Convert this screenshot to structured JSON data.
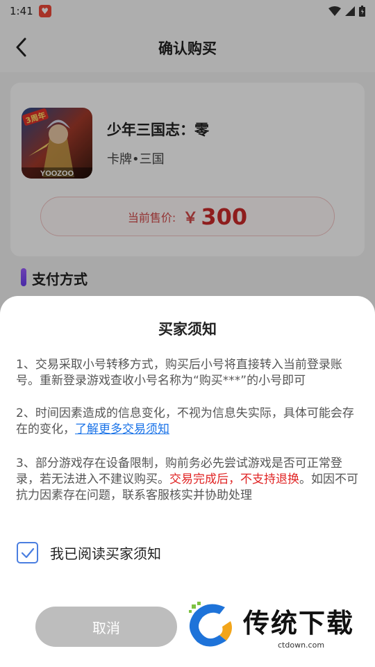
{
  "status_bar": {
    "time": "1:41"
  },
  "nav": {
    "title": "确认购买"
  },
  "product": {
    "badge": "3周年",
    "publisher_text": "YOOZOO",
    "name": "少年三国志：零",
    "tags": "卡牌•三国",
    "price_label": "当前售价:",
    "currency": "￥",
    "price": "300"
  },
  "payment": {
    "section_title": "支付方式"
  },
  "dialog": {
    "title": "买家须知",
    "notice1": "1、交易采取小号转移方式，购买后小号将直接转入当前登录账号。重新登录游戏查收小号名称为“购买***”的小号即可",
    "notice2_text": "2、时间因素造成的信息变化，不视为信息失实际，具体可能会存在的变化，",
    "notice2_link": "了解更多交易须知",
    "notice3_pre": "3、部分游戏存在设备限制，购前务必先尝试游戏是否可正常登录，若无法进入不建议购买。",
    "notice3_red": "交易完成后，不支持退换",
    "notice3_post": "。如因不可抗力因素存在问题，联系客服核实并协助处理",
    "agree_label": "我已阅读买家须知",
    "agree_checked": true,
    "cancel_label": "取消"
  },
  "watermark": {
    "text": "传统下载",
    "url": "ctdown.com"
  },
  "colors": {
    "accent_red": "#cc2a2a",
    "link_blue": "#1a73e8",
    "checkbox_blue": "#4a7ee0"
  }
}
